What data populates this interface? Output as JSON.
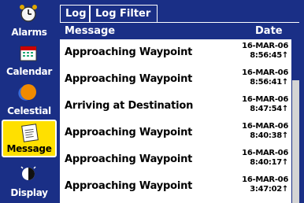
{
  "sidebar": {
    "items": [
      {
        "label": "Alarms",
        "icon": "alarm-clock-icon",
        "active": false
      },
      {
        "label": "Calendar",
        "icon": "calendar-icon",
        "active": false
      },
      {
        "label": "Celestial",
        "icon": "sun-moon-icon",
        "active": false
      },
      {
        "label": "Message",
        "icon": "message-icon",
        "active": true
      },
      {
        "label": "Display",
        "icon": "display-icon",
        "active": false
      }
    ]
  },
  "tabs": [
    {
      "label": "Log",
      "active": true
    },
    {
      "label": "Log Filter",
      "active": false
    }
  ],
  "table": {
    "columns": [
      "Message",
      "Date"
    ],
    "rows": [
      {
        "message": "Approaching Waypoint",
        "date": "16-MAR-06",
        "time": "8:56:45↑"
      },
      {
        "message": "Approaching Waypoint",
        "date": "16-MAR-06",
        "time": "8:56:41↑"
      },
      {
        "message": "Arriving at Destination",
        "date": "16-MAR-06",
        "time": "8:47:54↑"
      },
      {
        "message": "Approaching Waypoint",
        "date": "16-MAR-06",
        "time": "8:40:38↑"
      },
      {
        "message": "Approaching Waypoint",
        "date": "16-MAR-06",
        "time": "8:40:17↑"
      },
      {
        "message": "Approaching Waypoint",
        "date": "16-MAR-06",
        "time": "3:47:02↑"
      }
    ]
  },
  "colors": {
    "background": "#1a2f86",
    "active_item": "#ffe000",
    "list": "#ffffff"
  }
}
